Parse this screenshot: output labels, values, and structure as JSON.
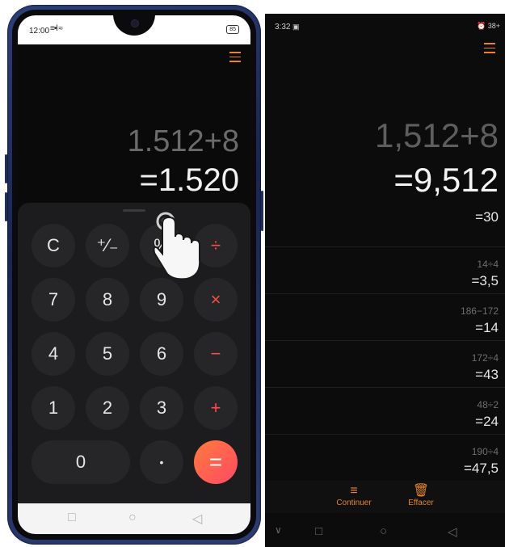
{
  "left": {
    "status": {
      "time": "12:00",
      "signal": "≡•l ≈",
      "battery": "85"
    },
    "expression": "1.512+8",
    "result": "=1.520",
    "keys": [
      {
        "label": "C",
        "name": "key-clear"
      },
      {
        "label": "⁺⁄₋",
        "name": "key-sign"
      },
      {
        "label": "%",
        "name": "key-percent"
      },
      {
        "label": "÷",
        "name": "key-divide"
      },
      {
        "label": "7",
        "name": "key-7"
      },
      {
        "label": "8",
        "name": "key-8"
      },
      {
        "label": "9",
        "name": "key-9"
      },
      {
        "label": "×",
        "name": "key-multiply"
      },
      {
        "label": "4",
        "name": "key-4"
      },
      {
        "label": "5",
        "name": "key-5"
      },
      {
        "label": "6",
        "name": "key-6"
      },
      {
        "label": "−",
        "name": "key-minus"
      },
      {
        "label": "1",
        "name": "key-1"
      },
      {
        "label": "2",
        "name": "key-2"
      },
      {
        "label": "3",
        "name": "key-3"
      },
      {
        "label": "+",
        "name": "key-plus"
      },
      {
        "label": "0",
        "name": "key-0"
      },
      {
        "label": "•",
        "name": "key-decimal"
      },
      {
        "label": "=",
        "name": "key-equals"
      }
    ],
    "nav": {
      "back": "◁",
      "home": "○",
      "recent": "□"
    }
  },
  "right": {
    "status": {
      "time": "3:32",
      "icon": "▣",
      "right": "⏰ 38+"
    },
    "expression": "1,512+8",
    "result": "=9,512",
    "history": [
      {
        "expr": "",
        "result": "=30"
      },
      {
        "expr": "14÷4",
        "result": "=3,5"
      },
      {
        "expr": "186−172",
        "result": "=14"
      },
      {
        "expr": "172÷4",
        "result": "=43"
      },
      {
        "expr": "48÷2",
        "result": "=24"
      },
      {
        "expr": "190÷4",
        "result": "=47,5"
      }
    ],
    "actions": {
      "continue": "Continuer",
      "clear": "Effacer"
    },
    "nav": {
      "chevron": "∨",
      "recent": "□",
      "home": "○",
      "back": "◁"
    }
  },
  "colors": {
    "accent": "#e8842c",
    "operator": "#ff4b4b",
    "equals_from": "#ff7a3d",
    "equals_to": "#ff4a63"
  }
}
